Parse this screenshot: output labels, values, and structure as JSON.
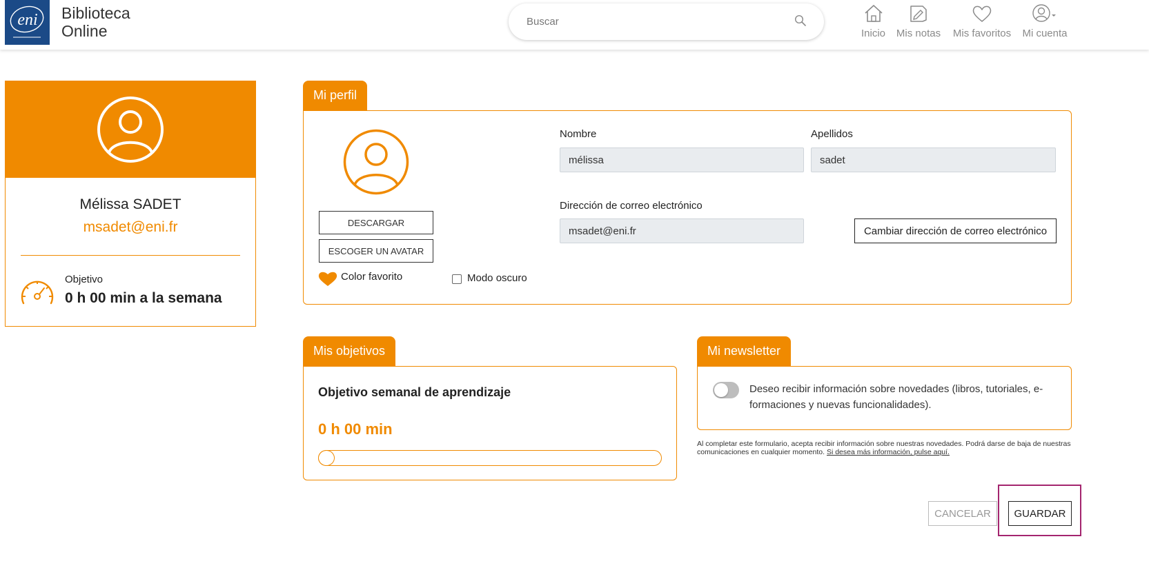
{
  "header": {
    "logo_text": "eni",
    "brand_line1": "Biblioteca",
    "brand_line2": "Online",
    "search": {
      "placeholder": "Buscar"
    },
    "nav": [
      {
        "label": "Inicio",
        "icon": "home-icon"
      },
      {
        "label": "Mis notas",
        "icon": "notes-icon"
      },
      {
        "label": "Mis favoritos",
        "icon": "heart-icon"
      },
      {
        "label": "Mi cuenta",
        "icon": "user-icon"
      }
    ]
  },
  "user_card": {
    "name": "Mélissa SADET",
    "email": "msadet@eni.fr",
    "objective_label": "Objetivo",
    "objective_value": "0 h 00 min a la semana"
  },
  "profile": {
    "tab": "Mi perfil",
    "download_button": "DESCARGAR",
    "avatar_button": "ESCOGER UN AVATAR",
    "favorite_color_label": "Color favorito",
    "dark_mode_label": "Modo oscuro",
    "dark_mode_checked": false,
    "first_name_label": "Nombre",
    "first_name_value": "mélissa",
    "last_name_label": "Apellidos",
    "last_name_value": "sadet",
    "email_label": "Dirección de correo electrónico",
    "email_value": "msadet@eni.fr",
    "change_email_button": "Cambiar dirección de correo electrónico"
  },
  "goals": {
    "tab": "Mis objetivos",
    "heading": "Objetivo semanal de aprendizaje",
    "value": "0 h 00 min",
    "slider_fraction": 0
  },
  "newsletter": {
    "tab": "Mi newsletter",
    "enabled": false,
    "text": "Deseo recibir información sobre novedades (libros, tutoriales, e-formaciones y nuevas funcionalidades).",
    "legal_text": "Al completar este formulario, acepta recibir información sobre nuestras novedades. Podrá darse de baja de nuestras comunicaciones en cualquier momento.",
    "legal_link": "Si desea más información, pulse aquí."
  },
  "actions": {
    "cancel": "CANCELAR",
    "save": "GUARDAR"
  },
  "colors": {
    "accent": "#f08a00",
    "brand_blue": "#1b4a87",
    "highlight": "#a3246e",
    "field_bg": "#e9ecef"
  }
}
